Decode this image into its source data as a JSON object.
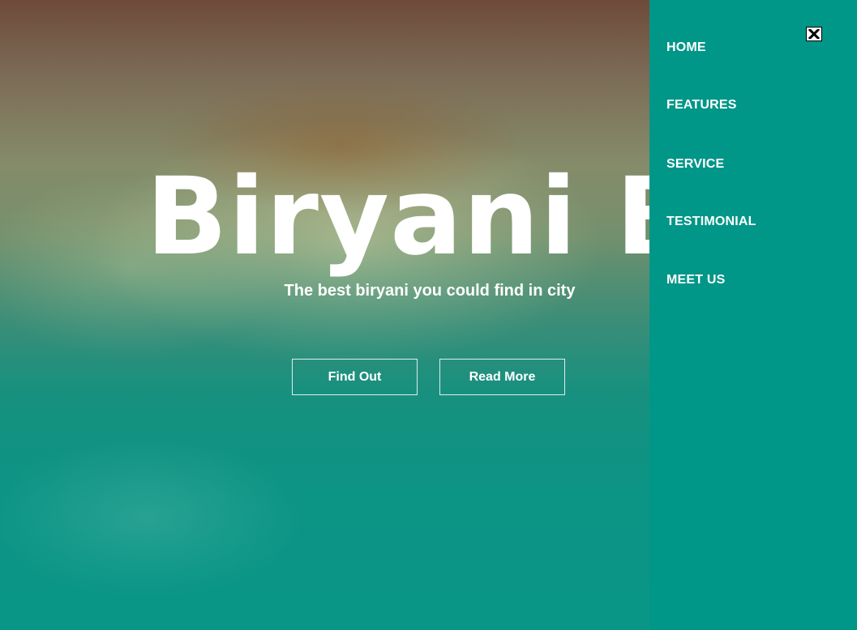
{
  "hero": {
    "title": "Biryani Ba",
    "subtitle": "The best biryani you could find in city",
    "buttons": {
      "find_out": "Find Out",
      "read_more": "Read More"
    }
  },
  "sidenav": {
    "close_icon": "close-icon",
    "items": [
      {
        "label": "HOME"
      },
      {
        "label": "FEATURES"
      },
      {
        "label": "SERVICE"
      },
      {
        "label": "TESTIMONIAL"
      },
      {
        "label": "MEET US"
      }
    ]
  },
  "colors": {
    "drawer": "#009688",
    "text": "#ffffff"
  }
}
